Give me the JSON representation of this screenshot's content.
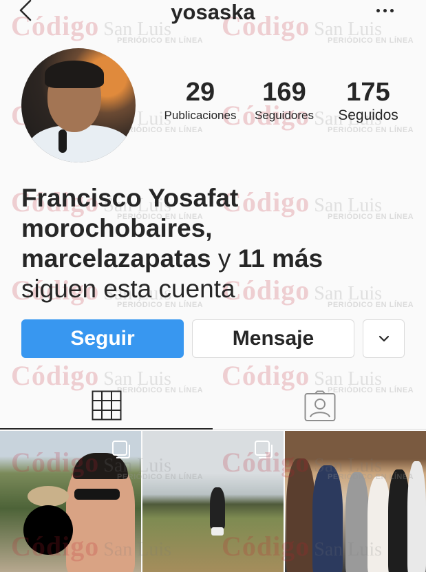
{
  "header": {
    "username": "yosaska",
    "back_icon": "chevron-left-icon",
    "more_icon": "more-horizontal-icon"
  },
  "profile": {
    "avatar_icon": "avatar",
    "stats": [
      {
        "value": "29",
        "label": "Publicaciones"
      },
      {
        "value": "169",
        "label": "Seguidores"
      },
      {
        "value": "175",
        "label": "Seguidos"
      }
    ]
  },
  "followed_by": {
    "name1": "Francisco Yosafat",
    "name2": "morochobaires,",
    "name3": "marcelazapatas",
    "joiner": "y",
    "others": "11 más",
    "suffix": "siguen esta cuenta"
  },
  "actions": {
    "follow_label": "Seguir",
    "message_label": "Mensaje",
    "chevron_icon": "chevron-down-icon"
  },
  "tabs": {
    "grid_icon": "grid-icon",
    "tagged_icon": "tagged-person-icon"
  },
  "watermark": {
    "brand": "Código",
    "city": "San Luis",
    "tagline": "PERIÓDICO EN LÍNEA"
  },
  "colors": {
    "follow_button": "#3897f0",
    "text": "#262626",
    "border": "#dbdbdb",
    "background": "#fafafa"
  }
}
